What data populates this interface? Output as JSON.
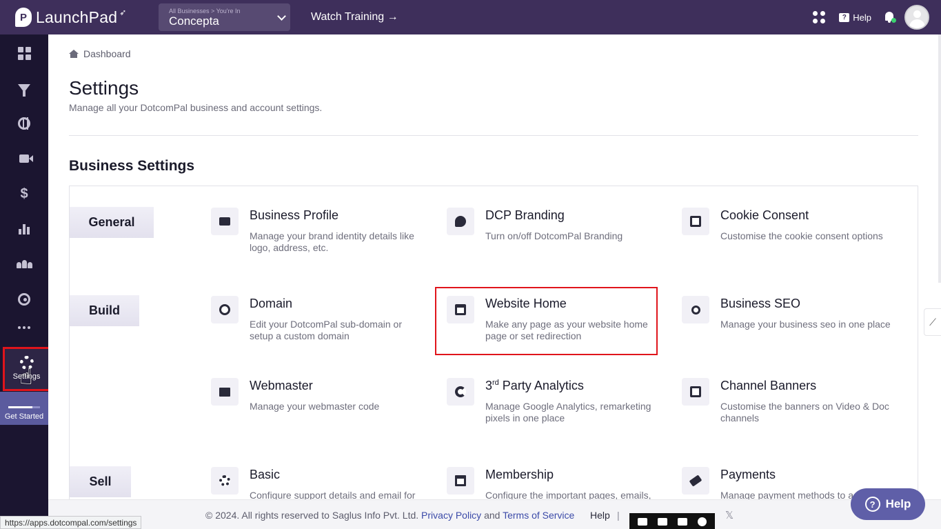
{
  "app": {
    "logo_text": "LaunchPad",
    "logo_mark": "P",
    "logo_icon": "rocket-icon"
  },
  "topbar": {
    "business_crumb": "All Businesses > You're In",
    "business_name": "Concepta",
    "watch_training": "Watch Training →",
    "help_label": "Help",
    "help_glyph": "?",
    "colors": {
      "bar": "#3e2f5b",
      "notification_dot": "#3bd16f"
    }
  },
  "sidebar": {
    "items": [
      {
        "name": "dashboard",
        "icon": "grid-icon"
      },
      {
        "name": "funnels",
        "icon": "funnel-icon"
      },
      {
        "name": "websites",
        "icon": "globe-icon"
      },
      {
        "name": "videos",
        "icon": "video-icon"
      },
      {
        "name": "sales",
        "icon": "dollar-icon",
        "glyph": "$"
      },
      {
        "name": "analytics",
        "icon": "chart-icon"
      },
      {
        "name": "members",
        "icon": "people-icon"
      },
      {
        "name": "performance",
        "icon": "gauge-icon"
      },
      {
        "name": "more",
        "icon": "more-icon"
      }
    ],
    "settings_label": "Settings",
    "get_started_label": "Get Started",
    "get_started_progress": 0.75
  },
  "breadcrumb": {
    "label": "Dashboard"
  },
  "page": {
    "title": "Settings",
    "subtitle": "Manage all your DotcomPal business and account settings."
  },
  "business_settings": {
    "title": "Business Settings",
    "categories": [
      "General",
      "Build",
      "Sell"
    ],
    "cards": [
      {
        "title": "Business Profile",
        "desc": "Manage your brand identity details like logo, address, etc.",
        "icon": "briefcase-icon"
      },
      {
        "title": "DCP Branding",
        "desc": "Turn on/off DotcomPal Branding",
        "icon": "chat-bubble-icon"
      },
      {
        "title": "Cookie Consent",
        "desc": "Customise the cookie consent options",
        "icon": "cookie-icon"
      },
      {
        "title": "Domain",
        "desc": "Edit your DotcomPal sub-domain or setup a custom domain",
        "icon": "globe-icon"
      },
      {
        "title": "Website Home",
        "desc": "Make any page as your website home page or set redirection",
        "icon": "browser-window-icon"
      },
      {
        "title": "Business SEO",
        "desc": "Manage your business seo in one place",
        "icon": "magnifier-icon"
      },
      {
        "title": "Webmaster",
        "desc": "Manage your webmaster code",
        "icon": "webmaster-icon"
      },
      {
        "title_prefix": "3",
        "title_sup": "rd",
        "title_rest": " Party Analytics",
        "desc": "Manage Google Analytics, remarketing pixels in one place",
        "icon": "pie-chart-icon"
      },
      {
        "title": "Channel Banners",
        "desc": "Customise the banners on Video & Doc channels",
        "icon": "tv-icon"
      },
      {
        "title": "Basic",
        "desc": "Configure support details and email for a",
        "icon": "gear-icon"
      },
      {
        "title": "Membership",
        "desc": "Configure the important pages, emails,",
        "icon": "membership-icon"
      },
      {
        "title": "Payments",
        "desc": "Manage payment methods to a",
        "icon": "card-icon"
      }
    ]
  },
  "footer": {
    "copyright": "©  2024. All rights reserved to Saglus Info Pvt. Ltd.",
    "privacy": "Privacy Policy",
    "and": "and",
    "terms": "Terms of Service",
    "help": "Help",
    "separator": "|",
    "x_glyph": "𝕏"
  },
  "help_fab": {
    "label": "Help",
    "glyph": "?"
  },
  "status_bar": {
    "url": "https://apps.dotcompal.com/settings"
  },
  "side_tab": {
    "glyph": "⟋"
  },
  "highlight_color": "#e0141b"
}
